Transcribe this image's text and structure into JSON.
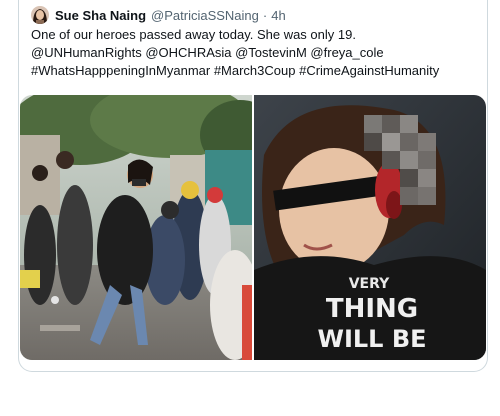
{
  "tweet": {
    "display_name": "Sue Sha Naing",
    "handle": "@PatriciaSSNaing",
    "separator": "·",
    "time": "4h",
    "text_lines": [
      "One of our heroes passed away today. She was only 19.",
      "@UNHumanRights @OHCHRAsia @TostevinM @freya_cole",
      "#WhatsHapppeningInMyanmar #March3Coup #CrimeAgainstHumanity"
    ],
    "media": [
      {
        "icon": "protest-street-photo"
      },
      {
        "icon": "victim-photo",
        "shirt_text_lines": [
          "VERY",
          "THING",
          "WILL BE"
        ]
      }
    ]
  },
  "colors": {
    "text": "#0f1419",
    "secondary_text": "#536471",
    "border": "#cfd9de"
  }
}
